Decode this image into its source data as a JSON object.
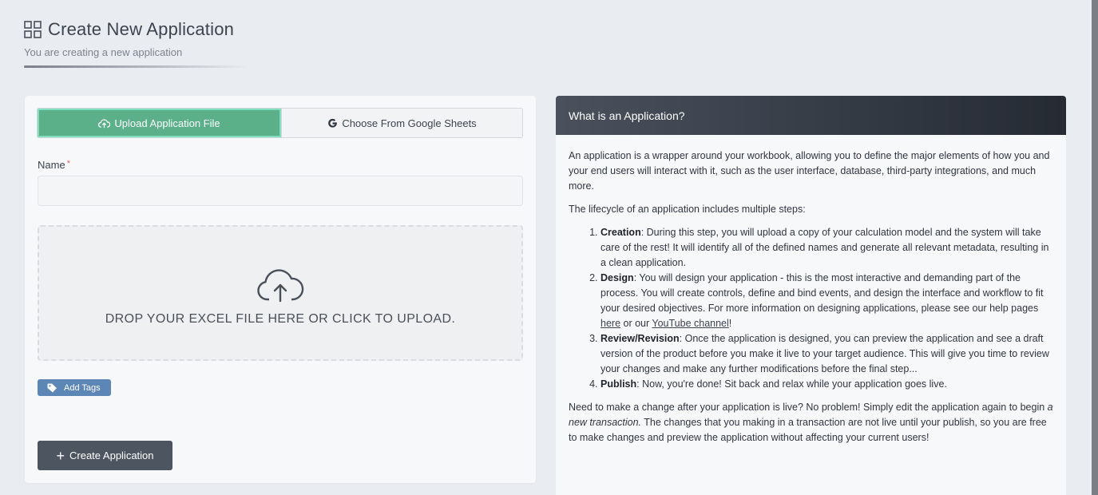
{
  "page": {
    "title": "Create New Application",
    "subtitle": "You are creating a new application"
  },
  "form": {
    "tabs": [
      {
        "label": "Upload Application File",
        "active": true
      },
      {
        "label": "Choose From Google Sheets",
        "active": false
      }
    ],
    "name_label": "Name",
    "required_marker": "*",
    "name_value": "",
    "dropzone_text": "DROP YOUR EXCEL FILE HERE OR CLICK TO UPLOAD.",
    "add_tags_label": "Add Tags",
    "create_button_label": "Create Application"
  },
  "info": {
    "header": "What is an Application?",
    "intro": "An application is a wrapper around your workbook, allowing you to define the major elements of how you and your end users will interact with it, such as the user interface, database, third-party integrations, and much more.",
    "lifecycle_intro": "The lifecycle of an application includes multiple steps:",
    "steps": [
      {
        "title": "Creation",
        "text": ": During this step, you will upload a copy of your calculation model and the system will take care of the rest! It will identify all of the defined names and generate all relevant metadata, resulting in a clean application."
      },
      {
        "title": "Design",
        "text": ": You will design your application - this is the most interactive and demanding part of the process. You will create controls, define and bind events, and design the interface and workflow to fit your desired objectives. For more information on designing applications, please see our help pages ",
        "link1": "here",
        "mid": " or our ",
        "link2": "YouTube channel",
        "end": "!"
      },
      {
        "title": "Review/Revision",
        "text": ": Once the application is designed, you can preview the application and see a draft version of the product before you make it live to your target audience. This will give you time to review your changes and make any further modifications before the final step..."
      },
      {
        "title": "Publish",
        "text": ": Now, you're done! Sit back and relax while your application goes live."
      }
    ],
    "outro_start": "Need to make a change after your application is live? No problem! Simply edit the application again to begin ",
    "outro_italic": "a new transaction.",
    "outro_end": " The changes that you making in a transaction are not live until your publish, so you are free to make changes and preview the application without affecting your current users!"
  },
  "colors": {
    "accent_green": "#5bb08a",
    "tag_blue": "#5c86b5",
    "dark_button": "#4d5560",
    "header_dark": "#252a33"
  },
  "icons": [
    "grid-icon",
    "cloud-upload-icon",
    "google-g-icon",
    "tag-icon",
    "plus-icon"
  ]
}
